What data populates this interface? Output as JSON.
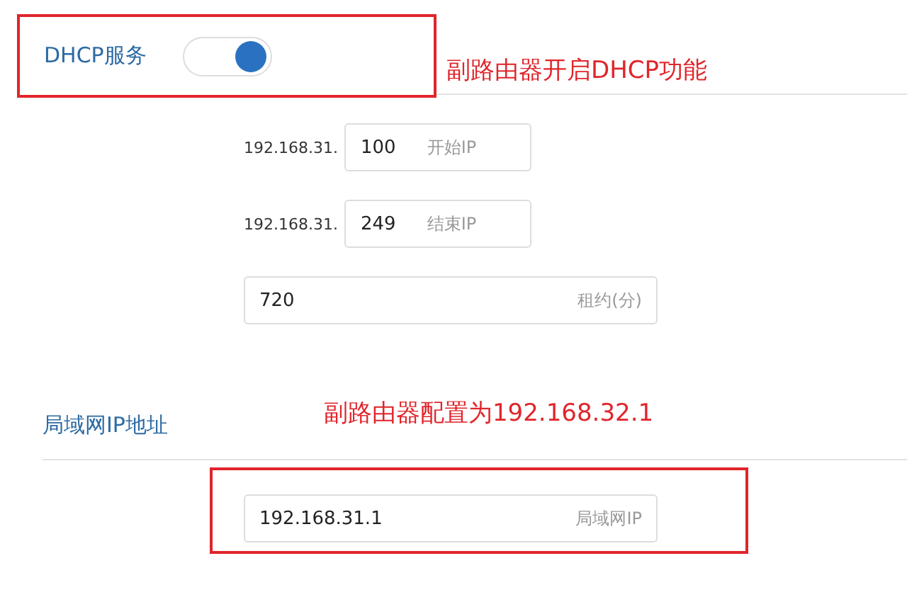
{
  "dhcp": {
    "label": "DHCP服务",
    "on": true
  },
  "dhcp_annotation": "副路由器开启DHCP功能",
  "ip_range": [
    {
      "prefix": "192.168.31.",
      "value": "100",
      "label": "开始IP"
    },
    {
      "prefix": "192.168.31.",
      "value": "249",
      "label": "结束IP"
    }
  ],
  "lease": {
    "value": "720",
    "label": "租约(分)"
  },
  "lan_section": {
    "title": "局域网IP地址",
    "annotation": "副路由器配置为192.168.32.1"
  },
  "lan_ip": {
    "value": "192.168.31.1",
    "label": "局域网IP"
  }
}
